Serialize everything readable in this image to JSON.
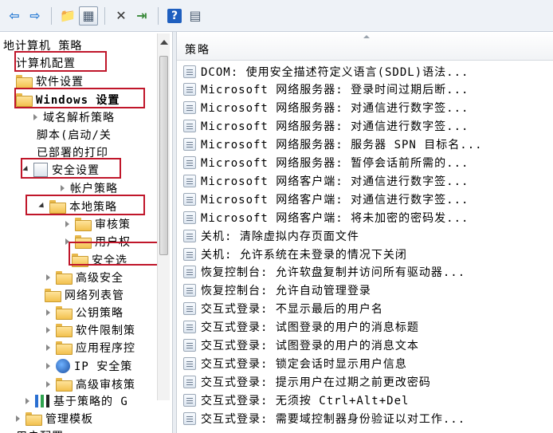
{
  "toolbar": {
    "buttons": [
      {
        "name": "back-button",
        "icon": "arrow-left-icon",
        "glyph": "⇦"
      },
      {
        "name": "forward-button",
        "icon": "arrow-right-icon",
        "glyph": "⇨"
      },
      {
        "name": "up-folder-button",
        "icon": "folder-up-icon",
        "glyph": "📁"
      },
      {
        "name": "show-hide-tree-button",
        "icon": "tree-view-icon",
        "glyph": "▦"
      },
      {
        "name": "delete-button",
        "icon": "delete-x-icon",
        "glyph": "✕"
      },
      {
        "name": "export-list-button",
        "icon": "export-icon",
        "glyph": "⇥"
      },
      {
        "name": "help-button",
        "icon": "help-icon",
        "glyph": "?"
      },
      {
        "name": "properties-button",
        "icon": "properties-icon",
        "glyph": "▤"
      }
    ]
  },
  "tree": {
    "items": [
      {
        "label": "地计算机 策略",
        "indent": 0,
        "twisty": "none",
        "icon": "none",
        "name": "tree-local-computer-policy"
      },
      {
        "label": "计算机配置",
        "indent": 0,
        "twisty": "none",
        "icon": "none",
        "name": "tree-computer-config"
      },
      {
        "label": "软件设置",
        "indent": 1,
        "twisty": "none",
        "icon": "folder",
        "name": "tree-software-settings"
      },
      {
        "label": "Windows 设置",
        "indent": 1,
        "twisty": "none",
        "icon": "folder",
        "name": "tree-windows-settings"
      },
      {
        "label": "域名解析策略",
        "indent": 2,
        "twisty": "closed",
        "icon": "none",
        "name": "tree-dns-policy"
      },
      {
        "label": "脚本(启动/关",
        "indent": 2,
        "twisty": "none",
        "icon": "none",
        "name": "tree-scripts"
      },
      {
        "label": "已部署的打印",
        "indent": 2,
        "twisty": "none",
        "icon": "none",
        "name": "tree-deployed-printers"
      },
      {
        "label": "安全设置",
        "indent": 1,
        "twisty": "open",
        "icon": "doc",
        "name": "tree-security-settings"
      },
      {
        "label": "帐户策略",
        "indent": 2,
        "twisty": "closed",
        "icon": "none",
        "name": "tree-account-policy"
      },
      {
        "label": "本地策略",
        "indent": 2,
        "twisty": "open",
        "icon": "folder",
        "name": "tree-local-policy"
      },
      {
        "label": "审核策",
        "indent": 3,
        "twisty": "closed",
        "icon": "folder",
        "name": "tree-audit-policy"
      },
      {
        "label": "用户权",
        "indent": 3,
        "twisty": "closed",
        "icon": "folder",
        "name": "tree-user-rights"
      },
      {
        "label": "安全选",
        "indent": 3,
        "twisty": "none",
        "icon": "folder",
        "name": "tree-security-options"
      },
      {
        "label": "高级安全",
        "indent": 2,
        "twisty": "closed",
        "icon": "folder",
        "name": "tree-advanced-security"
      },
      {
        "label": "网络列表管",
        "indent": 2,
        "twisty": "none",
        "icon": "folder",
        "name": "tree-network-list"
      },
      {
        "label": "公钥策略",
        "indent": 2,
        "twisty": "closed",
        "icon": "folder",
        "name": "tree-public-key"
      },
      {
        "label": "软件限制策",
        "indent": 2,
        "twisty": "closed",
        "icon": "folder",
        "name": "tree-software-restriction"
      },
      {
        "label": "应用程序控",
        "indent": 2,
        "twisty": "closed",
        "icon": "folder",
        "name": "tree-app-control"
      },
      {
        "label": "IP 安全策",
        "indent": 2,
        "twisty": "closed",
        "icon": "ip",
        "name": "tree-ip-security"
      },
      {
        "label": "高级审核策",
        "indent": 2,
        "twisty": "closed",
        "icon": "folder",
        "name": "tree-advanced-audit"
      },
      {
        "label": "基于策略的 G",
        "indent": 1,
        "twisty": "closed",
        "icon": "chart",
        "name": "tree-policy-qos"
      },
      {
        "label": "管理模板",
        "indent": 0,
        "twisty": "closed",
        "icon": "folder",
        "name": "tree-admin-templates"
      },
      {
        "label": "用户配置",
        "indent": 0,
        "twisty": "none",
        "icon": "none",
        "name": "tree-user-config"
      }
    ]
  },
  "list": {
    "column_title": "策略",
    "rows": [
      "DCOM: 使用安全描述符定义语言(SDDL)语法...",
      "Microsoft 网络服务器: 登录时间过期后断...",
      "Microsoft 网络服务器: 对通信进行数字签...",
      "Microsoft 网络服务器: 对通信进行数字签...",
      "Microsoft 网络服务器: 服务器 SPN 目标名...",
      "Microsoft 网络服务器: 暂停会话前所需的...",
      "Microsoft 网络客户端: 对通信进行数字签...",
      "Microsoft 网络客户端: 对通信进行数字签...",
      "Microsoft 网络客户端: 将未加密的密码发...",
      "关机: 清除虚拟内存页面文件",
      "关机: 允许系统在未登录的情况下关闭",
      "恢复控制台: 允许软盘复制并访问所有驱动器...",
      "恢复控制台: 允许自动管理登录",
      "交互式登录: 不显示最后的用户名",
      "交互式登录: 试图登录的用户的消息标题",
      "交互式登录: 试图登录的用户的消息文本",
      "交互式登录: 锁定会话时显示用户信息",
      "交互式登录: 提示用户在过期之前更改密码",
      "交互式登录: 无须按 Ctrl+Alt+Del",
      "交互式登录: 需要域控制器身份验证以对工作..."
    ]
  }
}
